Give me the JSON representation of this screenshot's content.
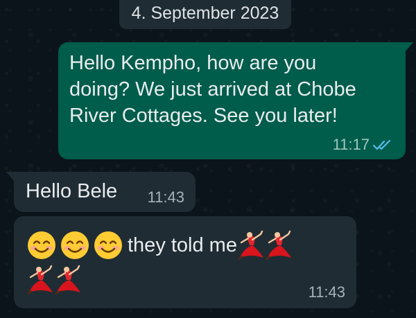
{
  "chat": {
    "date_label": "4. September 2023",
    "messages": [
      {
        "direction": "outgoing",
        "text": "Hello Kempho, how are you\ndoing? We just arrived at Chobe\nRiver Cottages. See you later!",
        "time": "11:17",
        "status_icon": "double-check-read-icon"
      },
      {
        "direction": "incoming",
        "text": "Hello Bele",
        "time": "11:43"
      },
      {
        "direction": "incoming",
        "text": "they told me",
        "time": "11:43",
        "emoji_before": [
          "smiling-face-icon",
          "smiling-face-icon",
          "smiling-face-icon"
        ],
        "emoji_after": [
          "dancer-icon",
          "dancer-icon",
          "dancer-icon",
          "dancer-icon"
        ]
      }
    ]
  },
  "colors": {
    "background": "#0b141a",
    "outgoing_bubble": "#005c4b",
    "incoming_bubble": "#202c33",
    "date_pill": "#1f2c34",
    "read_ticks": "#53bdeb"
  }
}
